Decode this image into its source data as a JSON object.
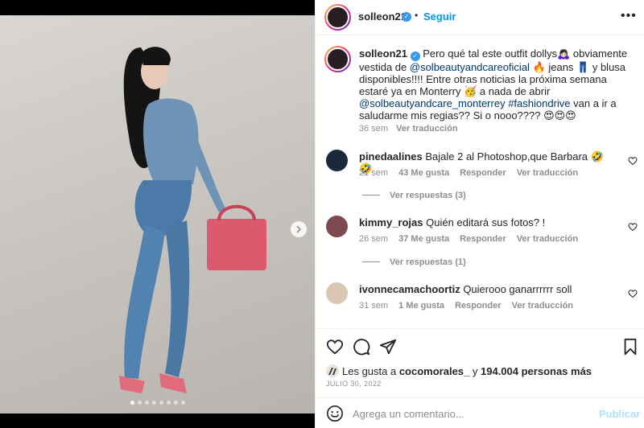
{
  "post": {
    "dots_count": 8,
    "active_dot": 0
  },
  "header": {
    "username": "solleon21",
    "separator": "•",
    "follow_label": "Seguir",
    "more_label": "•••"
  },
  "caption": {
    "username": "solleon21",
    "text_1": " Pero qué tal este outfit dollys🙇🏻‍♀️ obviamente vestida de ",
    "mention_1": "@solbeautyandcareoficial",
    "text_2": " 🔥 jeans 👖 y blusa disponibles!!!! Entre otras noticias la próxima semana estaré ya en Monterry 🥳 a nada de abrir ",
    "mention_2": "@solbeautyandcare_monterrey",
    "hashtag": " #fashiondrive",
    "text_3": " van a ir a saludarme mis regias?? Si o nooo???? 😍😍😍",
    "time": "36 sem",
    "translate": "Ver traducción"
  },
  "comments": [
    {
      "username": "pinedaalines",
      "text": " Bajale 2 al Photoshop,que Barbara 🤣🤣",
      "time": "21 sem",
      "likes": "43 Me gusta",
      "reply": "Responder",
      "translate": "Ver traducción",
      "replies": "Ver respuestas (3)",
      "avatar_color": "#1b2a3a"
    },
    {
      "username": "kimmy_rojas",
      "text": " Quién editará sus fotos? !",
      "time": "26 sem",
      "likes": "37 Me gusta",
      "reply": "Responder",
      "translate": "Ver traducción",
      "replies": "Ver respuestas (1)",
      "avatar_color": "#7a4a4f"
    },
    {
      "username": "ivonnecamachoortiz",
      "text": " Quierooo ganarrrrrr soll",
      "time": "31 sem",
      "likes": "1 Me gusta",
      "reply": "Responder",
      "translate": "Ver traducción",
      "avatar_color": "#d9c6b4"
    }
  ],
  "likes": {
    "prefix": "Les gusta a ",
    "user": "cocomorales_",
    "middle": " y ",
    "count": "194.004 personas más"
  },
  "date": "JULIO 30, 2022",
  "composer": {
    "placeholder": "Agrega un comentario...",
    "publish_label": "Publicar"
  },
  "colors": {
    "accent": "#0095f6",
    "publish_disabled": "#b2dffc",
    "muted": "#8e8e8e",
    "link": "#00376b"
  }
}
